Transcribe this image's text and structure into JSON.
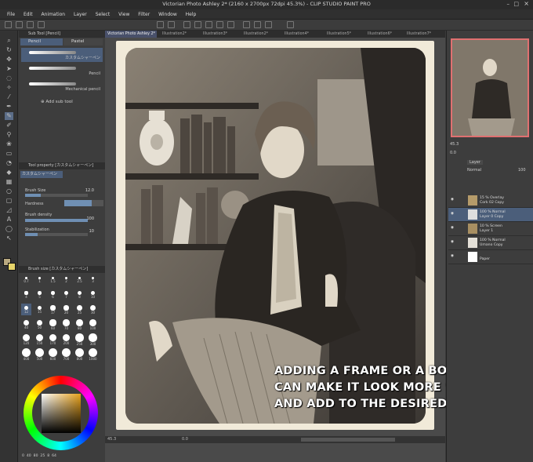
{
  "window": {
    "title": "Victorian Photo Ashley 2* (2160 x 2700px 72dpi 45.3%) - CLIP STUDIO PAINT PRO"
  },
  "menu": [
    "File",
    "Edit",
    "Animation",
    "Layer",
    "Select",
    "View",
    "Filter",
    "Window",
    "Help"
  ],
  "subtool": {
    "header": "Sub Tool [Pencil]",
    "tabs": [
      "Pencil",
      "Pastel"
    ],
    "brushes": [
      "カスタムシャーペン",
      "Pencil",
      "Mechanical pencil"
    ],
    "add_label": "Add sub tool"
  },
  "tool_property": {
    "header": "Tool property [カスタムシャーペン]",
    "brush_name": "カスタムシャーペン",
    "brush_size_label": "Brush Size",
    "brush_size_value": "12.0",
    "hardness_label": "Hardness",
    "density_label": "Brush density",
    "density_value": "100",
    "stabilization_label": "Stabilization",
    "stabilization_value": "10",
    "brush_size_fill": 0.25,
    "density_fill": 1.0,
    "stabilization_fill": 0.2
  },
  "brush_size_panel": {
    "header": "Brush size [カスタムシャーペン]",
    "sizes": [
      "0.7",
      "1",
      "1.5",
      "2",
      "2.5",
      "3",
      "4",
      "5",
      "6",
      "7",
      "8",
      "10",
      "12",
      "15",
      "17",
      "20",
      "25",
      "30",
      "40",
      "50",
      "60",
      "70",
      "80",
      "100",
      "120",
      "150",
      "170",
      "200",
      "250",
      "300",
      "400",
      "500",
      "600",
      "700",
      "800",
      "1000"
    ],
    "selected": "12"
  },
  "color_wheel": {
    "bottom_values": [
      "0",
      "40",
      "80",
      "25",
      "8",
      "64"
    ]
  },
  "canvas_tabs": [
    "Victorian Photo Ashley 2*",
    "Illustration2*",
    "Illustration3*",
    "Illustration2*",
    "Illustration4*",
    "Illustration5*",
    "Illustration6*",
    "Illustration7*"
  ],
  "status": {
    "zoom": "45.3",
    "extra": "0.0"
  },
  "overlay_text": [
    "ADDING A FRAME OR A BORDER",
    "CAN MAKE IT LOOK MORE “REAL”",
    "AND ADD TO THE DESIRED EFFECT."
  ],
  "navigator": {
    "zoom": "45.3",
    "angle": "0.0"
  },
  "layers": {
    "tab": "Layer",
    "blend": "Normal",
    "opacity": "100",
    "items": [
      {
        "line1": "15 % Overlay",
        "line2": "Cork 02 Copy"
      },
      {
        "line1": "100 % Normal",
        "line2": "Layer 0 Copy"
      },
      {
        "line1": "10 % Screen",
        "line2": "Layer 1"
      },
      {
        "line1": "100 % Normal",
        "line2": "Umano Copy"
      },
      {
        "line1": "",
        "line2": "Paper"
      }
    ]
  },
  "colors": {
    "accent": "#6f8fb3",
    "nav_border": "#e07070",
    "selected_layer": "#4b5e7a"
  }
}
